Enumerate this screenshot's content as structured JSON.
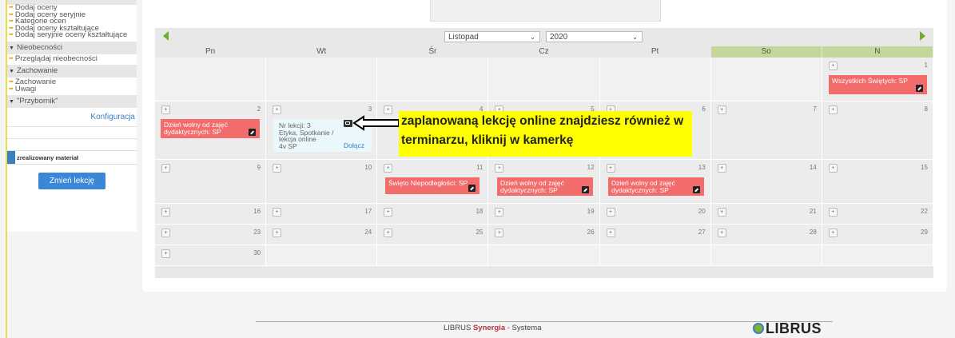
{
  "sidebar": {
    "links_top": [
      "Dodaj oceny",
      "Dodaj oceny seryjnie",
      "Kategorie ocen",
      "Dodaj oceny kształtujące",
      "Dodaj seryjnie oceny kształtujące"
    ],
    "section_nieobecnosci": "Nieobecności",
    "link_nieobecnosci": "Przeglądaj nieobecności",
    "section_zachowanie": "Zachowanie",
    "links_zachowanie": [
      "Zachowanie",
      "Uwagi"
    ],
    "section_przybornik": "\"Przybornik\"",
    "konfiguracja": "Konfiguracja",
    "realized_label": "zrealizowany materiał",
    "change_lesson_button": "Zmień lekcję"
  },
  "calendar": {
    "month": "Listopad",
    "year": "2020",
    "days": [
      "Pn",
      "Wt",
      "Śr",
      "Cz",
      "Pt",
      "So",
      "N"
    ],
    "weeks": [
      [
        "",
        "",
        "",
        "",
        "",
        "",
        "1"
      ],
      [
        "2",
        "3",
        "4",
        "5",
        "6",
        "7",
        "8"
      ],
      [
        "9",
        "10",
        "11",
        "12",
        "13",
        "14",
        "15"
      ],
      [
        "16",
        "17",
        "18",
        "19",
        "20",
        "21",
        "22"
      ],
      [
        "23",
        "24",
        "25",
        "26",
        "27",
        "28",
        "29"
      ],
      [
        "30",
        "",
        "",
        "",
        "",
        "",
        ""
      ]
    ],
    "events": {
      "all_saints": "Wszystkich Świętych: SP",
      "day_off": "Dzień wolny od zajęć dydaktycznych: SP",
      "independence": "Święto Niepodległości: SP"
    },
    "lesson": {
      "line1": "Nr lekcji: 3",
      "line2": "Etyka, Spotkanie /",
      "line3": "lekcja online",
      "line4": "4v SP",
      "join": "Dołącz"
    }
  },
  "callout": "zaplanowaną lekcję online znajdziesz również w terminarzu, kliknij w kamerkę",
  "footer": {
    "prefix": "LIBRUS",
    "brand": "Synergia",
    "suffix": " - Systema",
    "logo": "LIBRUS"
  },
  "colors": {
    "event": "#f26c6c",
    "weekend_header": "#c3d69b",
    "nav_arrow": "#6fad2c",
    "callout": "#ffff00",
    "button": "#3a87d6"
  }
}
